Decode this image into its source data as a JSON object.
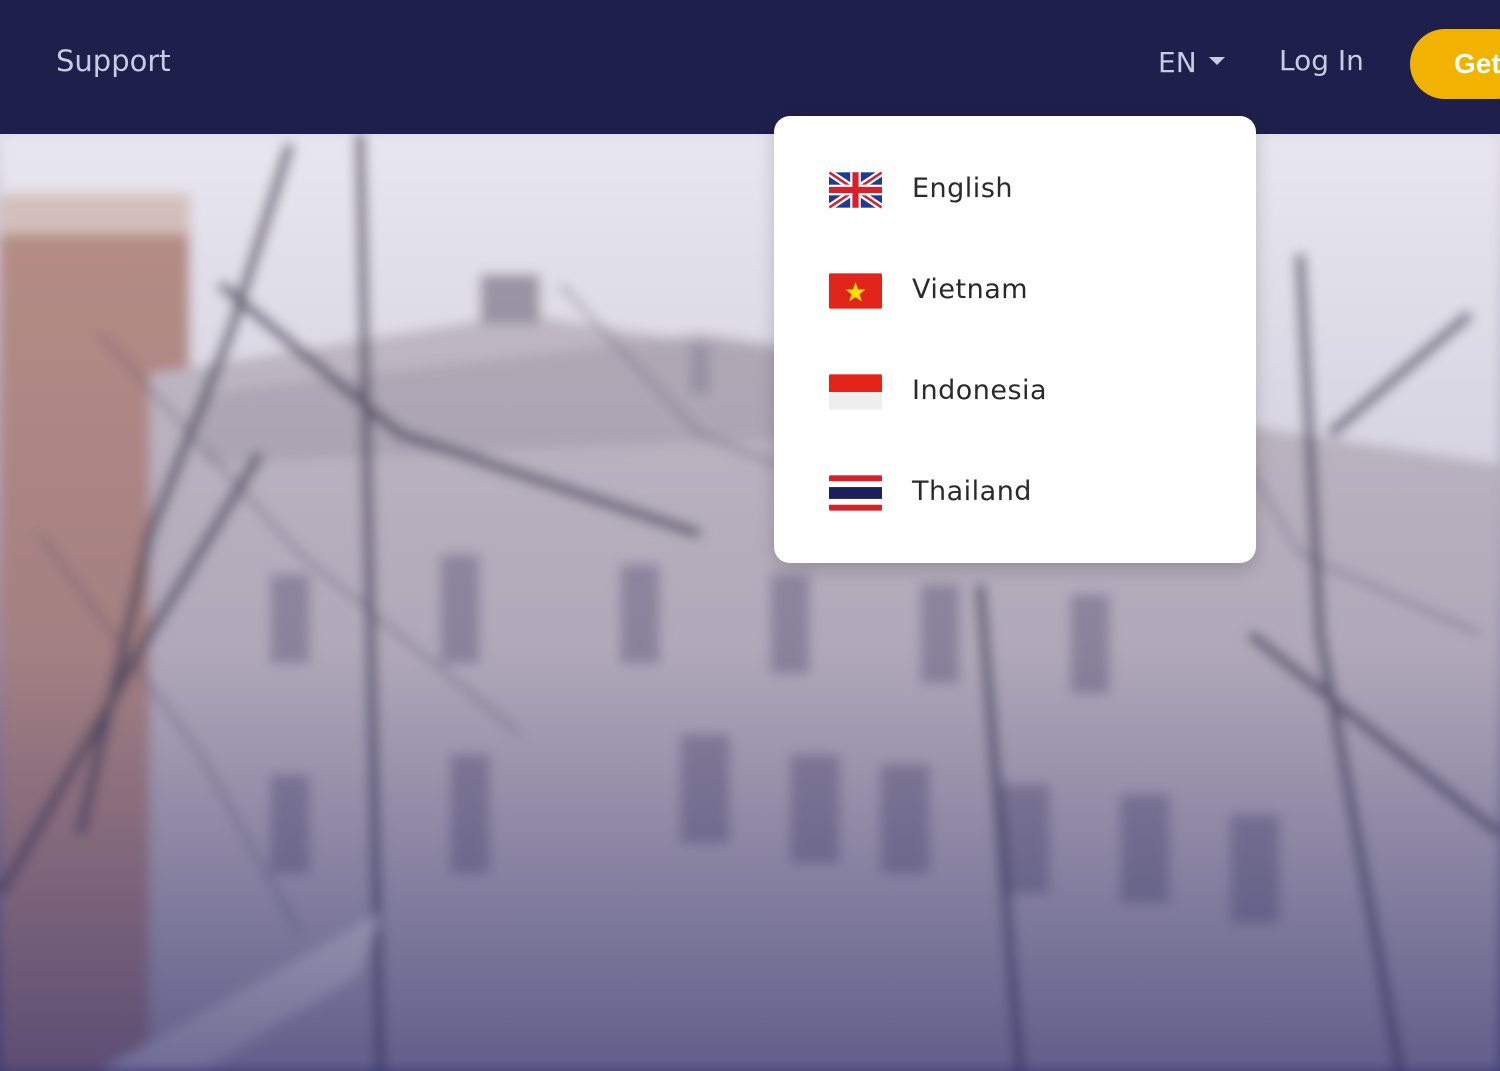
{
  "navbar": {
    "support_label": "Support",
    "language_code": "EN",
    "login_label": "Log In",
    "cta_label": "Get"
  },
  "language_menu": {
    "items": [
      {
        "label": "English",
        "flag": "uk-flag-icon"
      },
      {
        "label": "Vietnam",
        "flag": "vietnam-flag-icon"
      },
      {
        "label": "Indonesia",
        "flag": "indonesia-flag-icon"
      },
      {
        "label": "Thailand",
        "flag": "thailand-flag-icon"
      }
    ]
  },
  "colors": {
    "navbar_bg": "#1f1f4b",
    "nav_text": "#c9cbe3",
    "cta_bg": "#f2b200",
    "dropdown_bg": "#ffffff"
  }
}
